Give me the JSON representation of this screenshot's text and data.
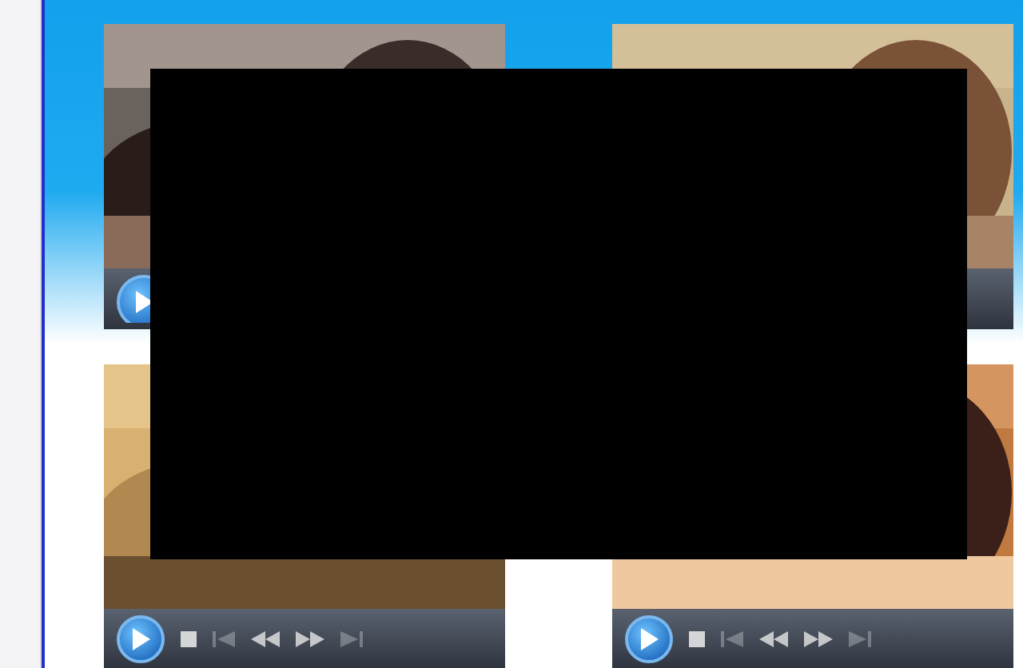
{
  "players": [
    {
      "kind": "video",
      "controls": [
        {
          "kind": "play",
          "clipped": true
        }
      ]
    },
    {
      "kind": "video"
    },
    {
      "kind": "video",
      "controls": [
        {
          "kind": "play",
          "clipped": false
        },
        {
          "kind": "stop",
          "disabled": false
        },
        {
          "kind": "previous",
          "disabled": true
        },
        {
          "kind": "rewind",
          "disabled": false
        },
        {
          "kind": "forward",
          "disabled": false
        },
        {
          "kind": "next",
          "disabled": true
        }
      ]
    },
    {
      "kind": "video",
      "controls": [
        {
          "kind": "play",
          "clipped": false
        },
        {
          "kind": "stop",
          "disabled": false
        },
        {
          "kind": "previous",
          "disabled": true
        },
        {
          "kind": "rewind",
          "disabled": false
        },
        {
          "kind": "forward",
          "disabled": false
        },
        {
          "kind": "next",
          "disabled": true
        }
      ]
    }
  ],
  "redaction": {
    "kind": "block"
  }
}
